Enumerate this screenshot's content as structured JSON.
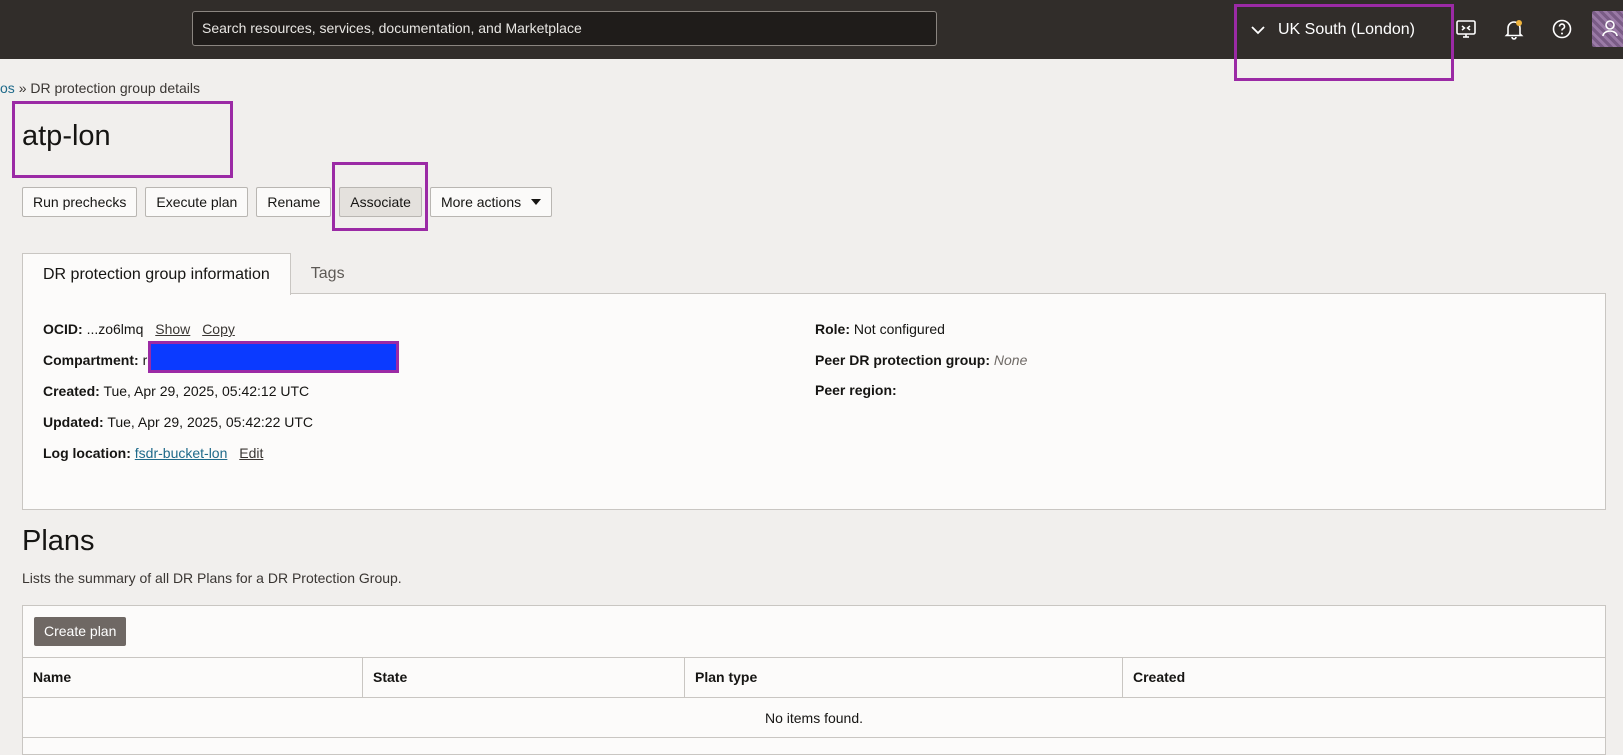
{
  "header": {
    "search_placeholder": "Search resources, services, documentation, and Marketplace",
    "region": "UK South (London)",
    "icons": [
      "chevron-down-icon",
      "cloud-shell-icon",
      "bell-icon",
      "help-icon",
      "user-avatar-icon"
    ]
  },
  "breadcrumb": {
    "prev_fragment": "os",
    "separator": "»",
    "current": "DR protection group details"
  },
  "page_title": "atp-lon",
  "actions": {
    "run_prechecks": "Run prechecks",
    "execute_plan": "Execute plan",
    "rename": "Rename",
    "associate": "Associate",
    "more_actions": "More actions"
  },
  "tabs": {
    "info": "DR protection group information",
    "tags": "Tags"
  },
  "info": {
    "ocid_label": "OCID:",
    "ocid_value": "...zo6lmq",
    "ocid_show": "Show",
    "ocid_copy": "Copy",
    "compartment_label": "Compartment:",
    "compartment_value": "r",
    "created_label": "Created:",
    "created_value": "Tue, Apr 29, 2025, 05:42:12 UTC",
    "updated_label": "Updated:",
    "updated_value": "Tue, Apr 29, 2025, 05:42:22 UTC",
    "log_label": "Log location:",
    "log_value": "fsdr-bucket-lon",
    "log_edit": "Edit",
    "role_label": "Role:",
    "role_value": "Not configured",
    "peer_group_label": "Peer DR protection group:",
    "peer_group_value": "None",
    "peer_region_label": "Peer region:"
  },
  "plans": {
    "title": "Plans",
    "description": "Lists the summary of all DR Plans for a DR Protection Group.",
    "create_button": "Create plan",
    "columns": [
      "Name",
      "State",
      "Plan type",
      "Created"
    ],
    "empty_message": "No items found."
  },
  "colors": {
    "highlight": "#9b2aa5",
    "redaction": "#0b3aff",
    "topbar": "#312d2a"
  }
}
